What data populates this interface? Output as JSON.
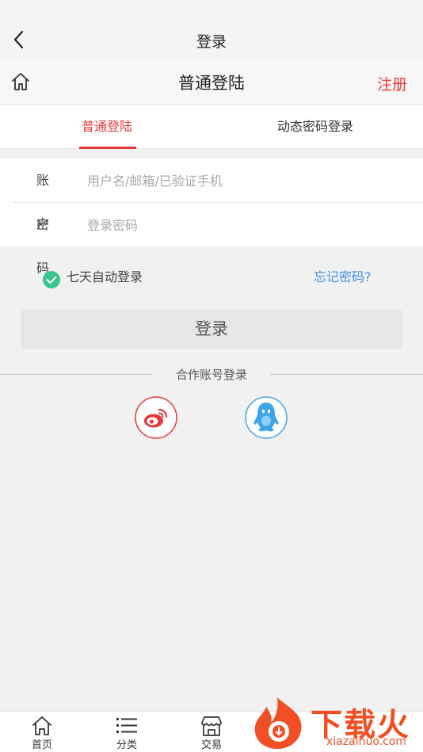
{
  "header": {
    "title": "登录"
  },
  "subheader": {
    "title": "普通登陆",
    "register_label": "注册"
  },
  "tabs": [
    {
      "label": "普通登陆",
      "active": true
    },
    {
      "label": "动态密码登录",
      "active": false
    }
  ],
  "form": {
    "account": {
      "label": "账户",
      "placeholder": "用户名/邮箱/已验证手机",
      "value": ""
    },
    "password": {
      "label": "密码",
      "placeholder": "登录密码",
      "value": ""
    }
  },
  "options": {
    "auto_login_label": "七天自动登录",
    "auto_login_checked": true,
    "forgot_label": "忘记密码?"
  },
  "login_button": {
    "label": "登录"
  },
  "partner": {
    "title": "合作账号登录",
    "providers": [
      {
        "icon": "weibo-icon",
        "color": "#e3393c"
      },
      {
        "icon": "qq-icon",
        "color": "#3ea6e8"
      }
    ]
  },
  "bottom_nav": [
    {
      "label": "首页",
      "icon": "home-icon"
    },
    {
      "label": "分类",
      "icon": "list-icon"
    },
    {
      "label": "交易",
      "icon": "store-icon"
    }
  ],
  "watermark": {
    "text": "下载火",
    "sub": "xiazaihuo.com"
  },
  "colors": {
    "accent": "#e83a3a",
    "link": "#3f8fe0",
    "check": "#3cc48e"
  }
}
